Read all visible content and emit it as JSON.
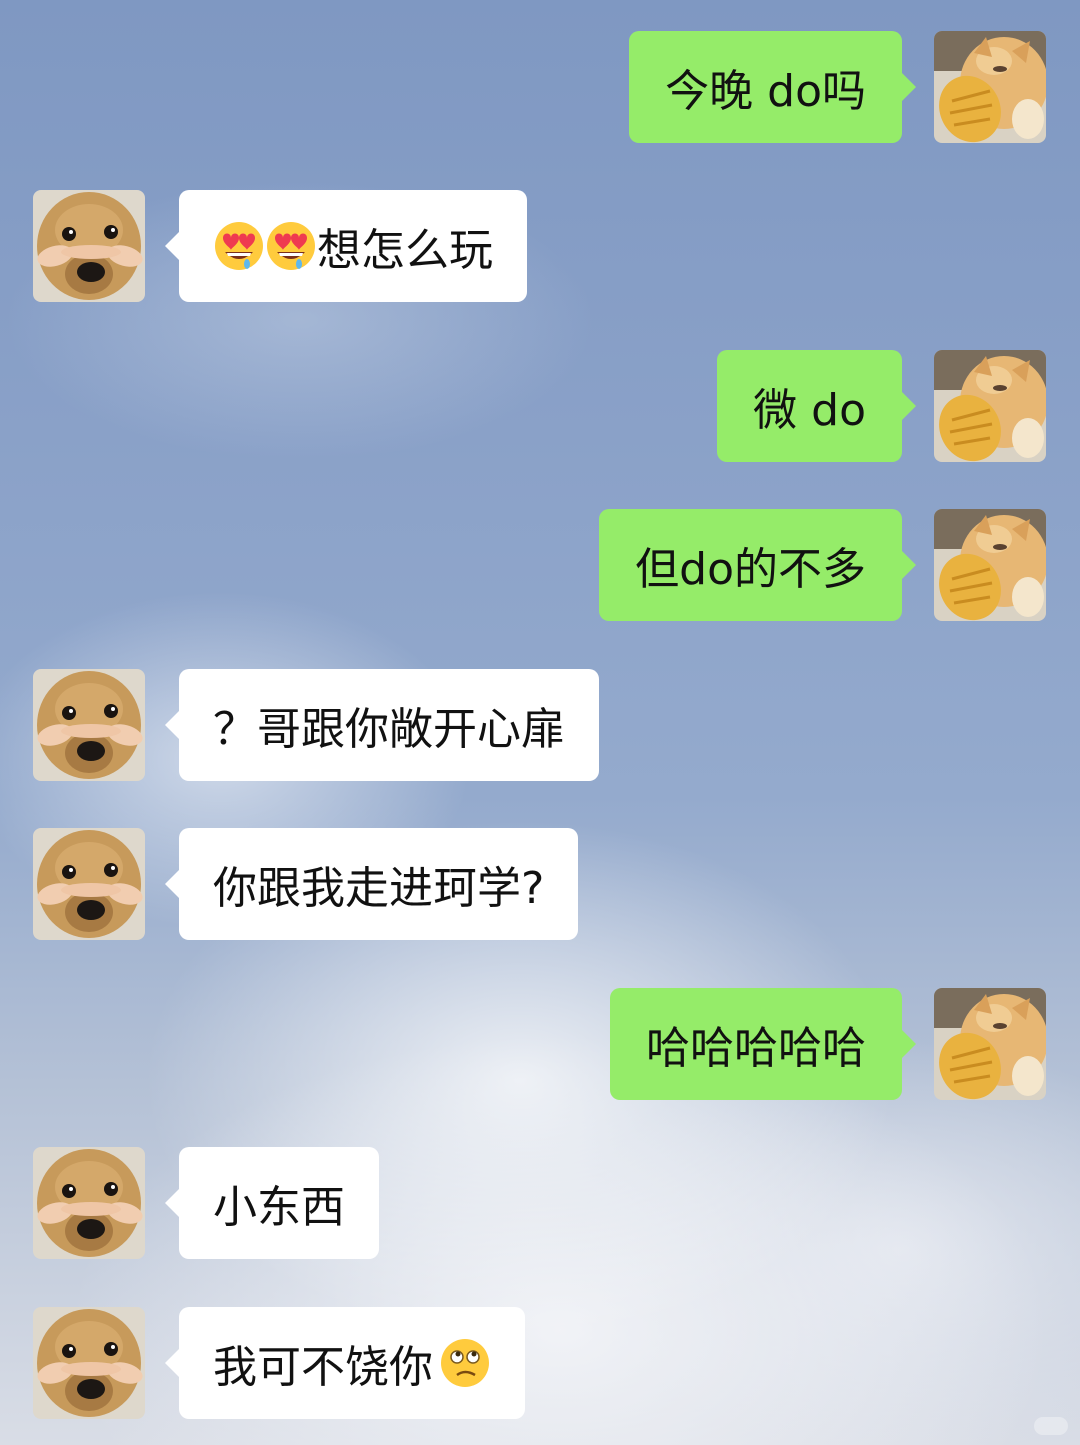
{
  "messages": [
    {
      "side": "outgoing",
      "text": "今晚 do吗"
    },
    {
      "side": "incoming",
      "emoji_prefix": [
        "smiling-face-with-heart-eyes-drooling-icon",
        "smiling-face-with-heart-eyes-drooling-icon"
      ],
      "text": "想怎么玩"
    },
    {
      "side": "outgoing",
      "text": "微 do"
    },
    {
      "side": "outgoing",
      "text": "但do的不多"
    },
    {
      "side": "incoming",
      "text": "？哥跟你敞开心扉"
    },
    {
      "side": "incoming",
      "text": "你跟我走进珂学?"
    },
    {
      "side": "outgoing",
      "text": "哈哈哈哈哈"
    },
    {
      "side": "incoming",
      "text": "小东西"
    },
    {
      "side": "incoming",
      "text": "我可不饶你",
      "emoji_suffix": "confused-eye-roll-face-icon"
    }
  ],
  "avatars": {
    "outgoing": "cat-holding-bread-avatar",
    "incoming": "dog-face-held-avatar"
  },
  "colors": {
    "outgoing_bubble": "#95ec69",
    "incoming_bubble": "#ffffff",
    "text": "#111111"
  }
}
